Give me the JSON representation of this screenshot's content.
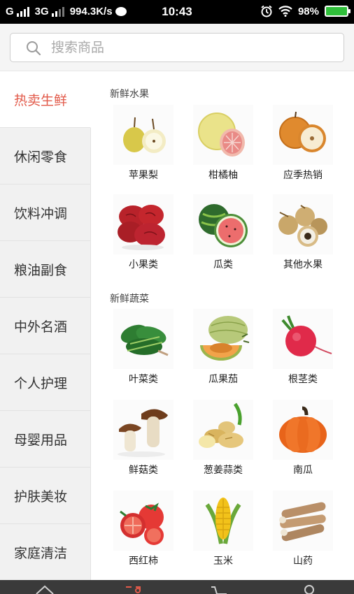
{
  "status_bar": {
    "network": "G",
    "network_type": "3G",
    "speed": "994.3K/s",
    "time": "10:43",
    "battery": "98%"
  },
  "search": {
    "placeholder": "搜索商品"
  },
  "sidebar": {
    "items": [
      {
        "label": "热卖生鲜"
      },
      {
        "label": "休闲零食"
      },
      {
        "label": "饮料冲调"
      },
      {
        "label": "粮油副食"
      },
      {
        "label": "中外名酒"
      },
      {
        "label": "个人护理"
      },
      {
        "label": "母婴用品"
      },
      {
        "label": "护肤美妆"
      },
      {
        "label": "家庭清洁"
      }
    ],
    "active_index": 0
  },
  "sections": [
    {
      "title": "新鲜水果",
      "items": [
        {
          "label": "苹果梨",
          "icon": "pear-icon"
        },
        {
          "label": "柑橘柚",
          "icon": "pomelo-icon"
        },
        {
          "label": "应季热销",
          "icon": "asian-pear-icon"
        },
        {
          "label": "小果类",
          "icon": "jujube-icon"
        },
        {
          "label": "瓜类",
          "icon": "watermelon-icon"
        },
        {
          "label": "其他水果",
          "icon": "longan-icon"
        }
      ]
    },
    {
      "title": "新鲜蔬菜",
      "items": [
        {
          "label": "叶菜类",
          "icon": "spinach-icon"
        },
        {
          "label": "瓜果茄",
          "icon": "melon-icon"
        },
        {
          "label": "根茎类",
          "icon": "radish-icon"
        },
        {
          "label": "鲜菇类",
          "icon": "mushroom-icon"
        },
        {
          "label": "葱姜蒜类",
          "icon": "ginger-icon"
        },
        {
          "label": "南瓜",
          "icon": "pumpkin-icon"
        },
        {
          "label": "西红柿",
          "icon": "tomato-icon"
        },
        {
          "label": "玉米",
          "icon": "corn-icon"
        },
        {
          "label": "山药",
          "icon": "yam-icon"
        }
      ]
    }
  ],
  "colors": {
    "accent": "#e25a4a",
    "sidebar_bg": "#f1f1f1",
    "nav_bg": "#3a3a3a"
  }
}
